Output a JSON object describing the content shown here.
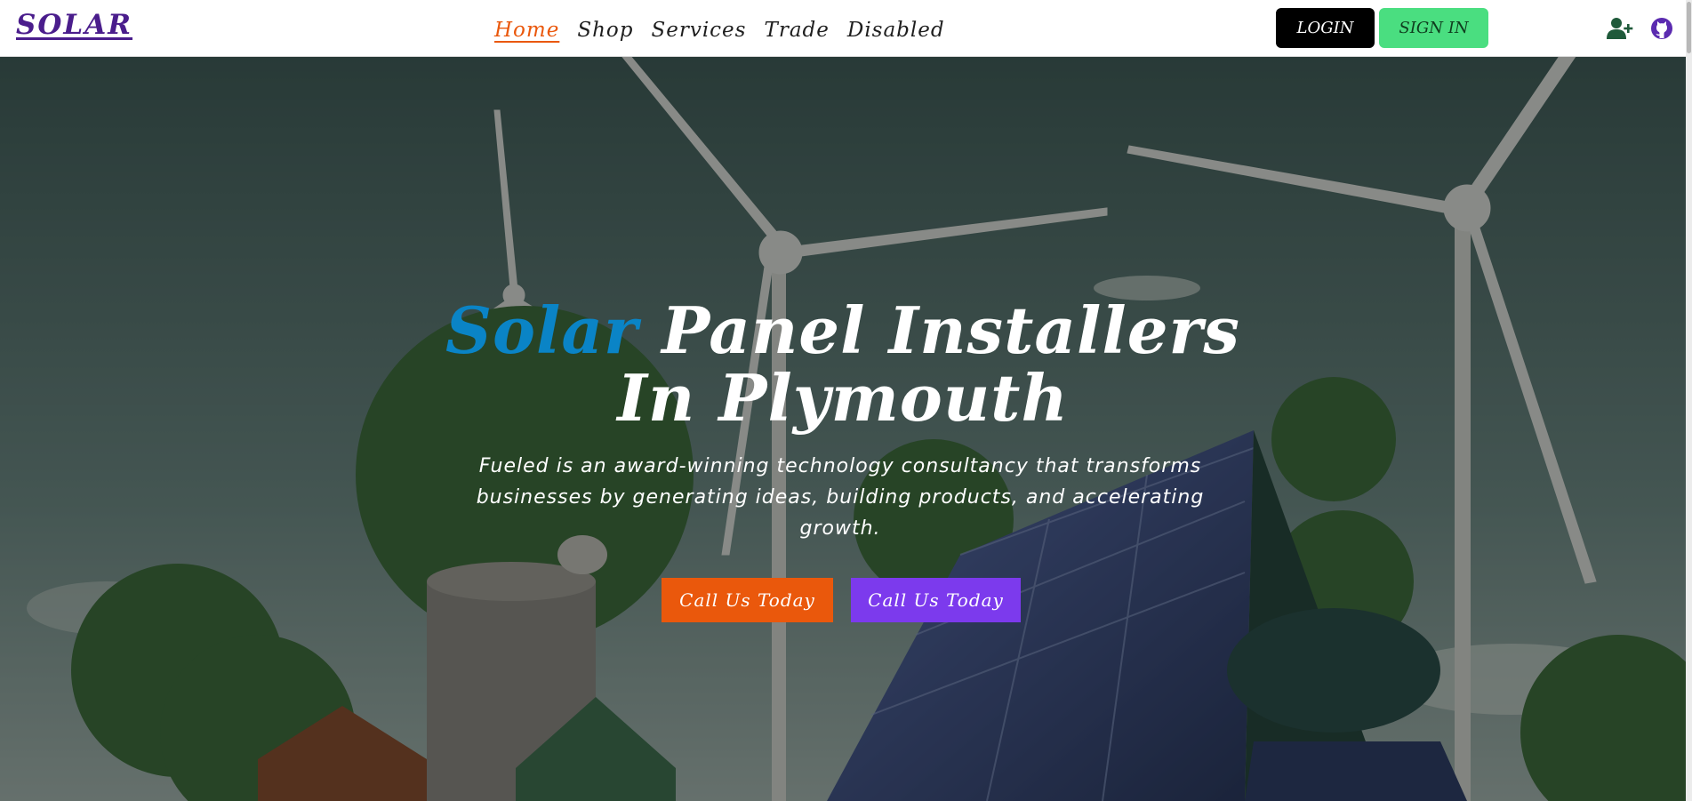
{
  "brand": {
    "name": "SOLAR",
    "color": "#4a1d8c"
  },
  "nav": {
    "links": [
      {
        "label": "Home",
        "active": true
      },
      {
        "label": "Shop",
        "active": false
      },
      {
        "label": "Services",
        "active": false
      },
      {
        "label": "Trade",
        "active": false
      },
      {
        "label": "Disabled",
        "active": false
      }
    ],
    "active_color": "#ea580c"
  },
  "auth": {
    "login_label": "LOGIN",
    "signin_label": "SIGN IN",
    "signin_color": "#4ade80"
  },
  "icons": {
    "add_user": "user-plus-icon",
    "github": "github-icon"
  },
  "hero": {
    "title_accent": "Solar",
    "title_rest": "Panel Installers",
    "title_line2": "In Plymouth",
    "accent_color": "#0a84c6",
    "subtitle": "Fueled is an award-winning technology consultancy that transforms businesses by generating ideas, building products, and accelerating growth.",
    "cta_primary": "Call Us Today",
    "cta_secondary": "Call Us Today",
    "cta_primary_color": "#ea580c",
    "cta_secondary_color": "#7c3aed"
  }
}
